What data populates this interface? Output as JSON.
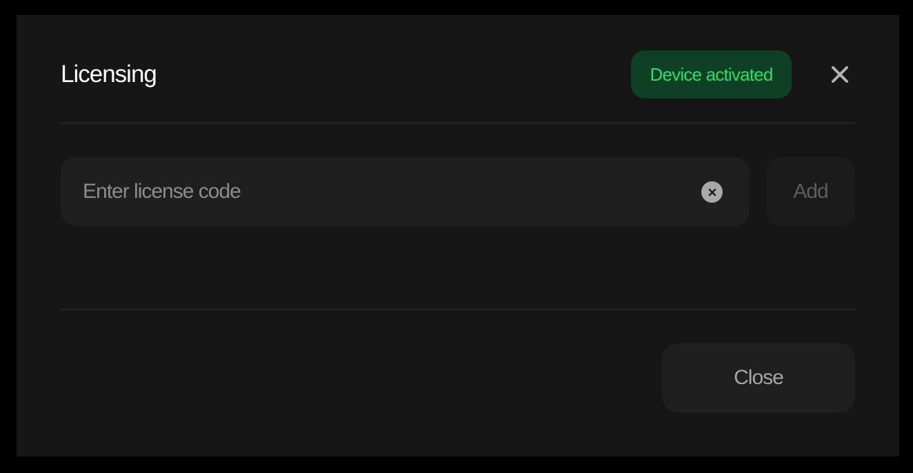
{
  "dialog": {
    "title": "Licensing",
    "status_badge": "Device activated",
    "close_icon": "close-icon"
  },
  "license": {
    "input_value": "",
    "placeholder": "Enter license code",
    "clear_icon": "clear-circle-x-icon",
    "add_label": "Add"
  },
  "footer": {
    "close_label": "Close"
  },
  "colors": {
    "background": "#000000",
    "dialog": "#161616",
    "badge_bg": "#0d4024",
    "badge_text": "#22e06a",
    "field_bg": "#1f1f1f"
  }
}
